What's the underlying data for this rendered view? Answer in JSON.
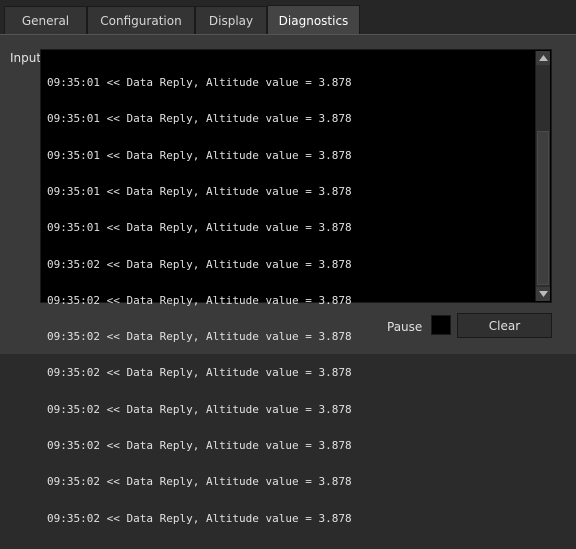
{
  "tabs": [
    {
      "label": "General"
    },
    {
      "label": "Configuration"
    },
    {
      "label": "Display"
    },
    {
      "label": "Diagnostics",
      "active": true
    }
  ],
  "section_title": "Input Data",
  "log_lines": [
    "09:35:01 << Data Reply, Altitude value = 3.878",
    "09:35:01 << Data Reply, Altitude value = 3.878",
    "09:35:01 << Data Reply, Altitude value = 3.878",
    "09:35:01 << Data Reply, Altitude value = 3.878",
    "09:35:01 << Data Reply, Altitude value = 3.878",
    "09:35:02 << Data Reply, Altitude value = 3.878",
    "09:35:02 << Data Reply, Altitude value = 3.878",
    "09:35:02 << Data Reply, Altitude value = 3.878",
    "09:35:02 << Data Reply, Altitude value = 3.878",
    "09:35:02 << Data Reply, Altitude value = 3.878",
    "09:35:02 << Data Reply, Altitude value = 3.878",
    "09:35:02 << Data Reply, Altitude value = 3.878",
    "09:35:02 << Data Reply, Altitude value = 3.878"
  ],
  "controls": {
    "pause_label": "Pause",
    "pause_checked": false,
    "clear_label": "Clear"
  },
  "icons": {
    "scroll_up": "triangle-up-icon",
    "scroll_down": "triangle-down-icon"
  },
  "colors": {
    "background": "#3a3a3a",
    "log_background": "#000000",
    "active_tab": "#444444"
  }
}
